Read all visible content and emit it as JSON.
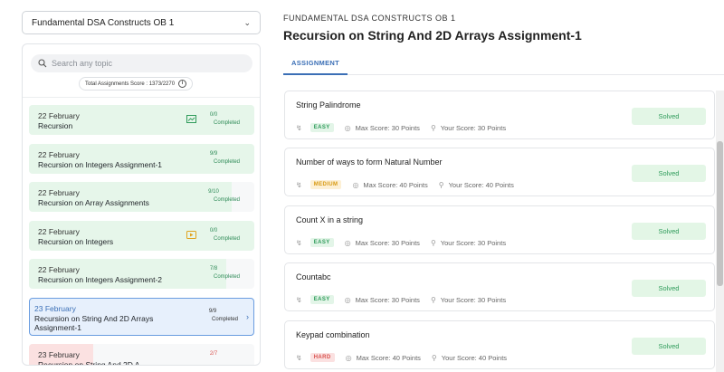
{
  "course_select": {
    "value": "Fundamental DSA Constructs OB 1"
  },
  "sidebar": {
    "search_placeholder": "Search any topic",
    "score_text": "Total Assignments Score : 1373/2270",
    "info_glyph": "i",
    "items": [
      {
        "date": "22 February",
        "title": "Recursion",
        "count": "0/0",
        "status": "Completed",
        "icon": "slides-icon",
        "state": "green",
        "progress": 1.0
      },
      {
        "date": "22 February",
        "title": "Recursion on Integers Assignment-1",
        "count": "9/9",
        "status": "Completed",
        "state": "green",
        "progress": 1.0
      },
      {
        "date": "22 February",
        "title": "Recursion on Array Assignments",
        "count": "9/10",
        "status": "Completed",
        "state": "green",
        "progress": 0.9
      },
      {
        "date": "22 February",
        "title": "Recursion on Integers",
        "count": "0/0",
        "status": "Completed",
        "icon": "video-icon",
        "state": "green",
        "progress": 1.0
      },
      {
        "date": "22 February",
        "title": "Recursion on Integers Assignment-2",
        "count": "7/8",
        "status": "Completed",
        "state": "green",
        "progress": 0.875
      },
      {
        "date": "23 February",
        "title": "Recursion on String And 2D Arrays Assignment-1",
        "count": "9/9",
        "status": "Completed",
        "state": "active",
        "arrow": "›"
      },
      {
        "date": "23 February",
        "title": "Recursion on String And 2D A",
        "count": "2/7",
        "status": "",
        "state": "red",
        "progress": 0.286
      }
    ]
  },
  "main": {
    "breadcrumb": "FUNDAMENTAL DSA CONSTRUCTS OB 1",
    "title": "Recursion on String And 2D Arrays Assignment-1",
    "tab_label": "ASSIGNMENT",
    "problems": [
      {
        "name": "String Palindrome",
        "difficulty": "EASY",
        "max_score": "Max Score: 30 Points",
        "your_score": "Your Score: 30 Points",
        "status": "Solved"
      },
      {
        "name": "Number of ways to form Natural Number",
        "difficulty": "MEDIUM",
        "max_score": "Max Score: 40 Points",
        "your_score": "Your Score: 40 Points",
        "status": "Solved"
      },
      {
        "name": "Count X in a string",
        "difficulty": "EASY",
        "max_score": "Max Score: 30 Points",
        "your_score": "Your Score: 30 Points",
        "status": "Solved"
      },
      {
        "name": "Countabc",
        "difficulty": "EASY",
        "max_score": "Max Score: 30 Points",
        "your_score": "Your Score: 30 Points",
        "status": "Solved"
      },
      {
        "name": "Keypad combination",
        "difficulty": "HARD",
        "max_score": "Max Score: 40 Points",
        "your_score": "Your Score: 40 Points",
        "status": "Solved"
      }
    ]
  },
  "colors": {
    "accent": "#3b6fb6",
    "completed_green": "#2e8b57",
    "solved_bg": "#e3f6e6"
  }
}
